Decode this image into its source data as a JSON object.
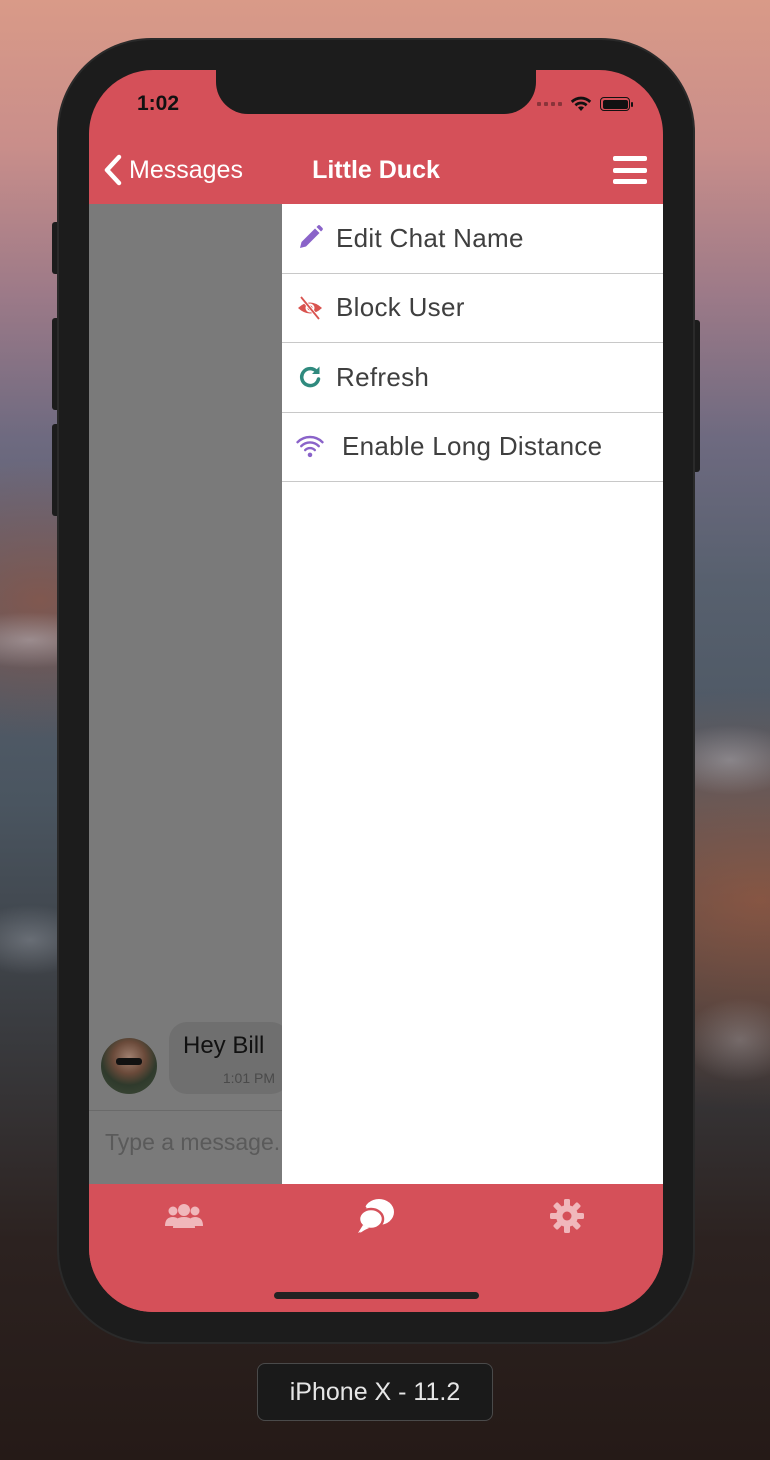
{
  "device": {
    "label": "iPhone X - 11.2"
  },
  "status_bar": {
    "time": "1:02",
    "icons": [
      "signal-icon",
      "wifi-icon",
      "battery-icon"
    ]
  },
  "nav_bar": {
    "back_label": "Messages",
    "title": "Little Duck",
    "menu_icon": "hamburger-menu-icon"
  },
  "drawer": {
    "items": [
      {
        "label": "Edit Chat Name",
        "icon": "pencil-icon",
        "icon_color": "#8a63c9"
      },
      {
        "label": "Block User",
        "icon": "eye-slash-icon",
        "icon_color": "#d9534f"
      },
      {
        "label": "Refresh",
        "icon": "refresh-icon",
        "icon_color": "#2f8a7e"
      },
      {
        "label": "Enable Long Distance",
        "icon": "wifi-icon",
        "icon_color": "#8a63c9"
      }
    ]
  },
  "chat": {
    "messages": [
      {
        "text": "Hey Bill",
        "time": "1:01 PM",
        "sender": "avatar"
      }
    ],
    "composer_placeholder": "Type a message..."
  },
  "tab_bar": {
    "tabs": [
      {
        "icon": "users-icon",
        "active": false
      },
      {
        "icon": "chat-bubbles-icon",
        "active": true
      },
      {
        "icon": "gear-icon",
        "active": false
      }
    ]
  },
  "colors": {
    "accent": "#d55059",
    "overlay": "#7a7a7a",
    "inactive_tab_icon": "#f0b7bb"
  }
}
